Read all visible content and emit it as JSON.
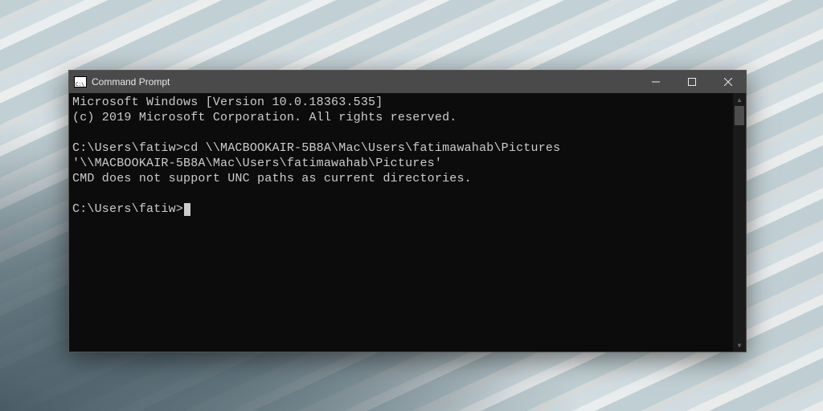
{
  "window": {
    "title": "Command Prompt"
  },
  "terminal": {
    "line1": "Microsoft Windows [Version 10.0.18363.535]",
    "line2": "(c) 2019 Microsoft Corporation. All rights reserved.",
    "blank1": "",
    "prompt1": "C:\\Users\\fatiw>cd \\\\MACBOOKAIR-5B8A\\Mac\\Users\\fatimawahab\\Pictures",
    "echo1": "'\\\\MACBOOKAIR-5B8A\\Mac\\Users\\fatimawahab\\Pictures'",
    "error1": "CMD does not support UNC paths as current directories.",
    "blank2": "",
    "prompt2": "C:\\Users\\fatiw>"
  }
}
